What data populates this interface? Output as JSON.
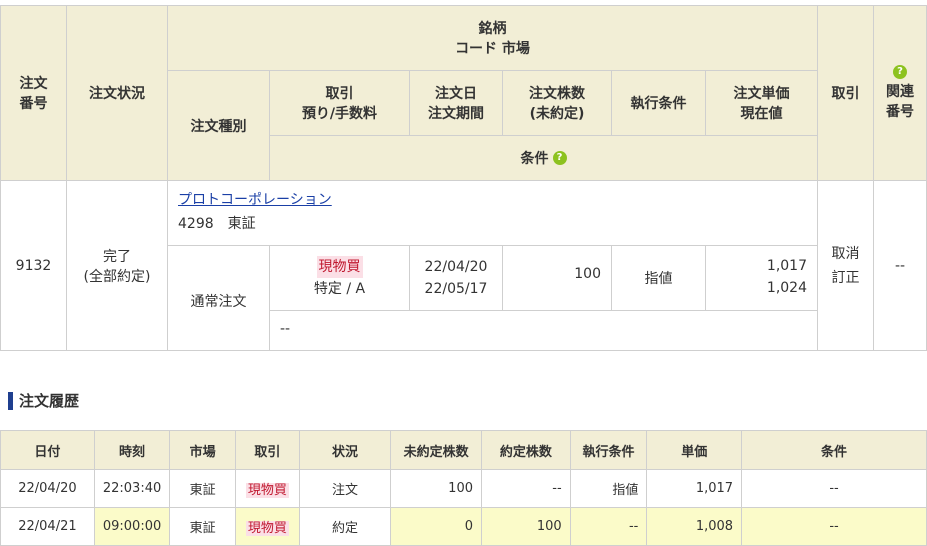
{
  "order_table": {
    "headers": {
      "order_no": "注文\n番号",
      "status": "注文状況",
      "brand": "銘柄\nコード 市場",
      "order_type": "注文種別",
      "trade": "取引\n預り/手数料",
      "order_date": "注文日\n注文期間",
      "qty": "注文株数\n(未約定)",
      "exec_cond": "執行条件",
      "price": "注文単価\n現在値",
      "cancel": "取引",
      "related": "関連\n番号",
      "condition": "条件"
    },
    "row": {
      "order_no": "9132",
      "status_line1": "完了",
      "status_line2": "(全部約定)",
      "brand_name": "プロトコーポレーション",
      "brand_code": "4298　東証",
      "order_type": "通常注文",
      "trade_type": "現物買",
      "account": "特定 / A",
      "order_date": "22/04/20",
      "period": "22/05/17",
      "qty": "100",
      "exec_cond": "指値",
      "unit_price": "1,017",
      "current_price": "1,024",
      "cancel_label": "取消",
      "modify_label": "訂正",
      "related": "--",
      "condition": "--"
    }
  },
  "history": {
    "title": "注文履歴",
    "columns": [
      "日付",
      "時刻",
      "市場",
      "取引",
      "状況",
      "未約定株数",
      "約定株数",
      "執行条件",
      "単価",
      "条件"
    ],
    "rows": [
      {
        "date": "22/04/20",
        "time": "22:03:40",
        "market": "東証",
        "trade": "現物買",
        "status": "注文",
        "unfilled": "100",
        "filled": "--",
        "cond": "指値",
        "price": "1,017",
        "condition": "--"
      },
      {
        "date": "22/04/21",
        "time": "09:00:00",
        "market": "東証",
        "trade": "現物買",
        "status": "約定",
        "unfilled": "0",
        "filled": "100",
        "cond": "--",
        "price": "1,008",
        "condition": "--"
      }
    ]
  },
  "colors": {
    "header_bg": "#f2eed6",
    "highlight_row": "#fbfbc9",
    "trade_pill_bg": "#fbdfe6",
    "trade_pill_text": "#c0182f",
    "help_icon": "#8dc21f",
    "section_bar": "#1f3f8f"
  }
}
